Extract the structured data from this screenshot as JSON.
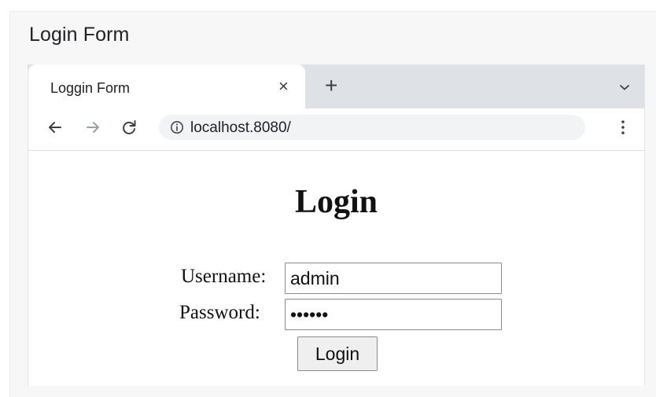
{
  "window": {
    "title": "Login Form"
  },
  "browser": {
    "tab": {
      "title": "Loggin  Form",
      "close_glyph": "×"
    },
    "new_tab_glyph": "+",
    "tab_menu_icon": "chevron-down-icon",
    "toolbar": {
      "back_icon": "back-arrow-icon",
      "forward_icon": "forward-arrow-icon",
      "reload_icon": "reload-icon",
      "site_info_icon": "info-icon",
      "url": "localhost.8080/",
      "menu_icon": "vertical-dots-icon"
    }
  },
  "page": {
    "heading": "Login",
    "username_label": "Username:",
    "username_value": "admin",
    "password_label": "Password:",
    "password_value": "123456",
    "submit_label": "Login"
  },
  "colors": {
    "tabstrip": "#dee1e6",
    "omnibox": "#f1f3f4",
    "outer_background": "#f7f7f7"
  }
}
